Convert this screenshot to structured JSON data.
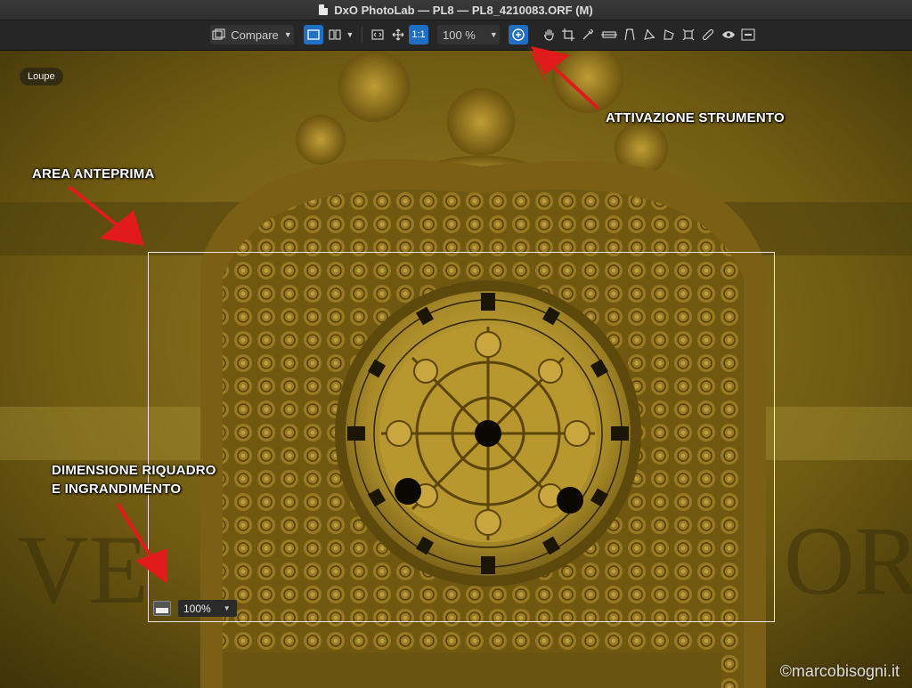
{
  "window": {
    "title": "DxO PhotoLab — PL8 — PL8_4210083.ORF (M)"
  },
  "toolbar": {
    "compare_label": "Compare",
    "one_to_one_label": "1:1",
    "zoom_value": "100 %"
  },
  "canvas": {
    "loupe_badge": "Loupe",
    "frame_zoom_value": "100%"
  },
  "annotations": {
    "tool_activation": "ATTIVAZIONE STRUMENTO",
    "preview_area": "AREA ANTEPRIMA",
    "frame_size_line1": "DIMENSIONE RIQUADRO",
    "frame_size_line2": "E INGRANDIMENTO"
  },
  "watermark": "©marcobisogni.it",
  "colors": {
    "accent": "#1f6fc5",
    "annotation_arrow": "#e11b1b"
  },
  "icons": [
    "compare-icon",
    "single-view-icon",
    "split-view-icon",
    "fit-icon",
    "move-icon",
    "loupe-icon",
    "hand-icon",
    "crop-icon",
    "picker-icon",
    "horizon-icon",
    "perspective-icon",
    "volume-deformation-icon",
    "constrained-crop-icon",
    "resize-icon",
    "repair-icon",
    "eye-icon",
    "histogram-toggle-icon"
  ]
}
